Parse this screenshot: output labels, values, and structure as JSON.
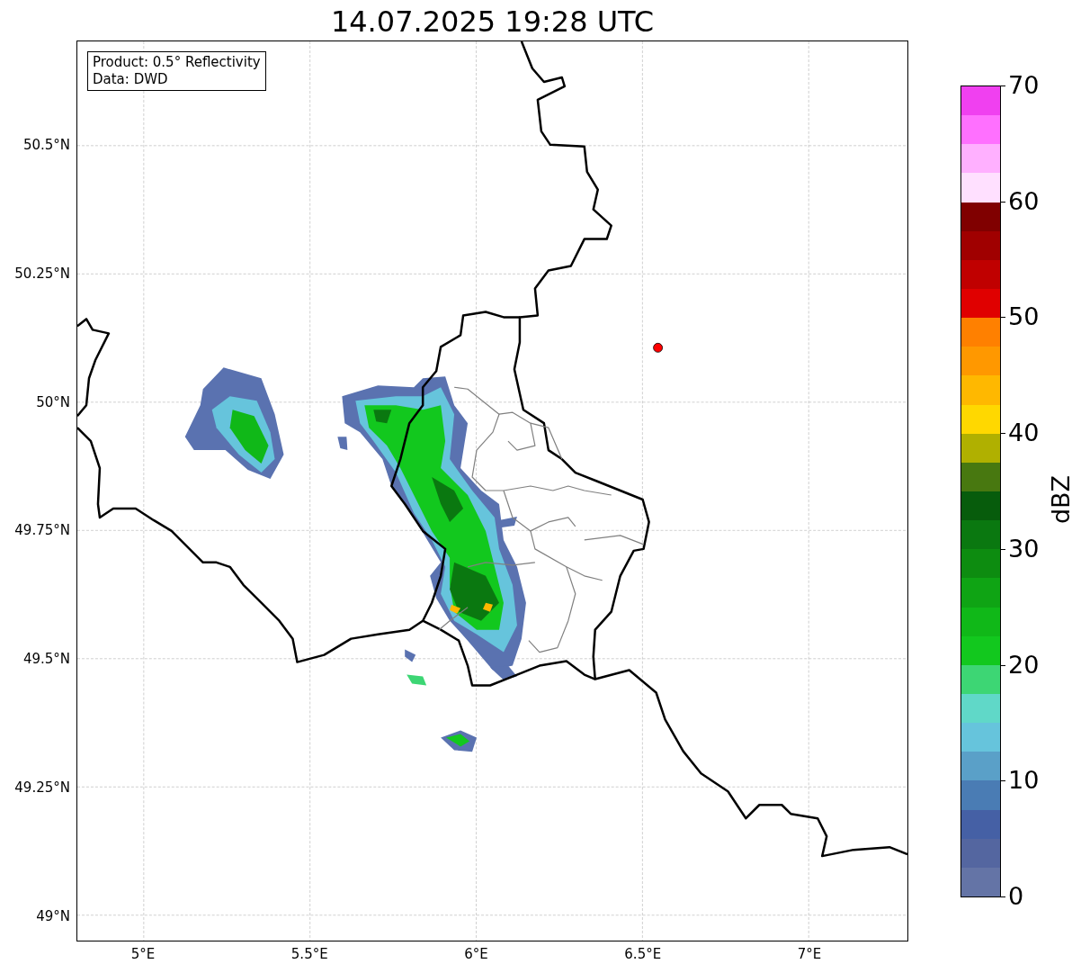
{
  "title": "14.07.2025 19:28 UTC",
  "map": {
    "info_lines": [
      "Product: 0.5° Reflectivity",
      "Data: DWD"
    ],
    "lon_ticks": [
      "5°E",
      "5.5°E",
      "6°E",
      "6.5°E",
      "7°E"
    ],
    "lat_ticks": [
      "50.5°N",
      "50.25°N",
      "50°N",
      "49.75°N",
      "49.5°N",
      "49.25°N",
      "49°N"
    ]
  },
  "colorbar": {
    "label": "dBZ",
    "ticks": [
      "70",
      "60",
      "50",
      "40",
      "30",
      "20",
      "10",
      "0"
    ],
    "segments": [
      {
        "color": "#6474a6"
      },
      {
        "color": "#5466a0"
      },
      {
        "color": "#4560a5"
      },
      {
        "color": "#4a7cb4"
      },
      {
        "color": "#5aa0c8"
      },
      {
        "color": "#66c4dc"
      },
      {
        "color": "#60d8c8"
      },
      {
        "color": "#3dd674"
      },
      {
        "color": "#12c81e"
      },
      {
        "color": "#10b818"
      },
      {
        "color": "#0fa414"
      },
      {
        "color": "#0d8c10"
      },
      {
        "color": "#0a7810"
      },
      {
        "color": "#075c0c"
      },
      {
        "color": "#487810"
      },
      {
        "color": "#b0b000"
      },
      {
        "color": "#ffd800"
      },
      {
        "color": "#ffb800"
      },
      {
        "color": "#ff9800"
      },
      {
        "color": "#ff8000"
      },
      {
        "color": "#e00000"
      },
      {
        "color": "#c00000"
      },
      {
        "color": "#a00000"
      },
      {
        "color": "#800000"
      },
      {
        "color": "#ffe0ff"
      },
      {
        "color": "#ffb0ff"
      },
      {
        "color": "#ff70ff"
      },
      {
        "color": "#f040f0"
      }
    ]
  }
}
